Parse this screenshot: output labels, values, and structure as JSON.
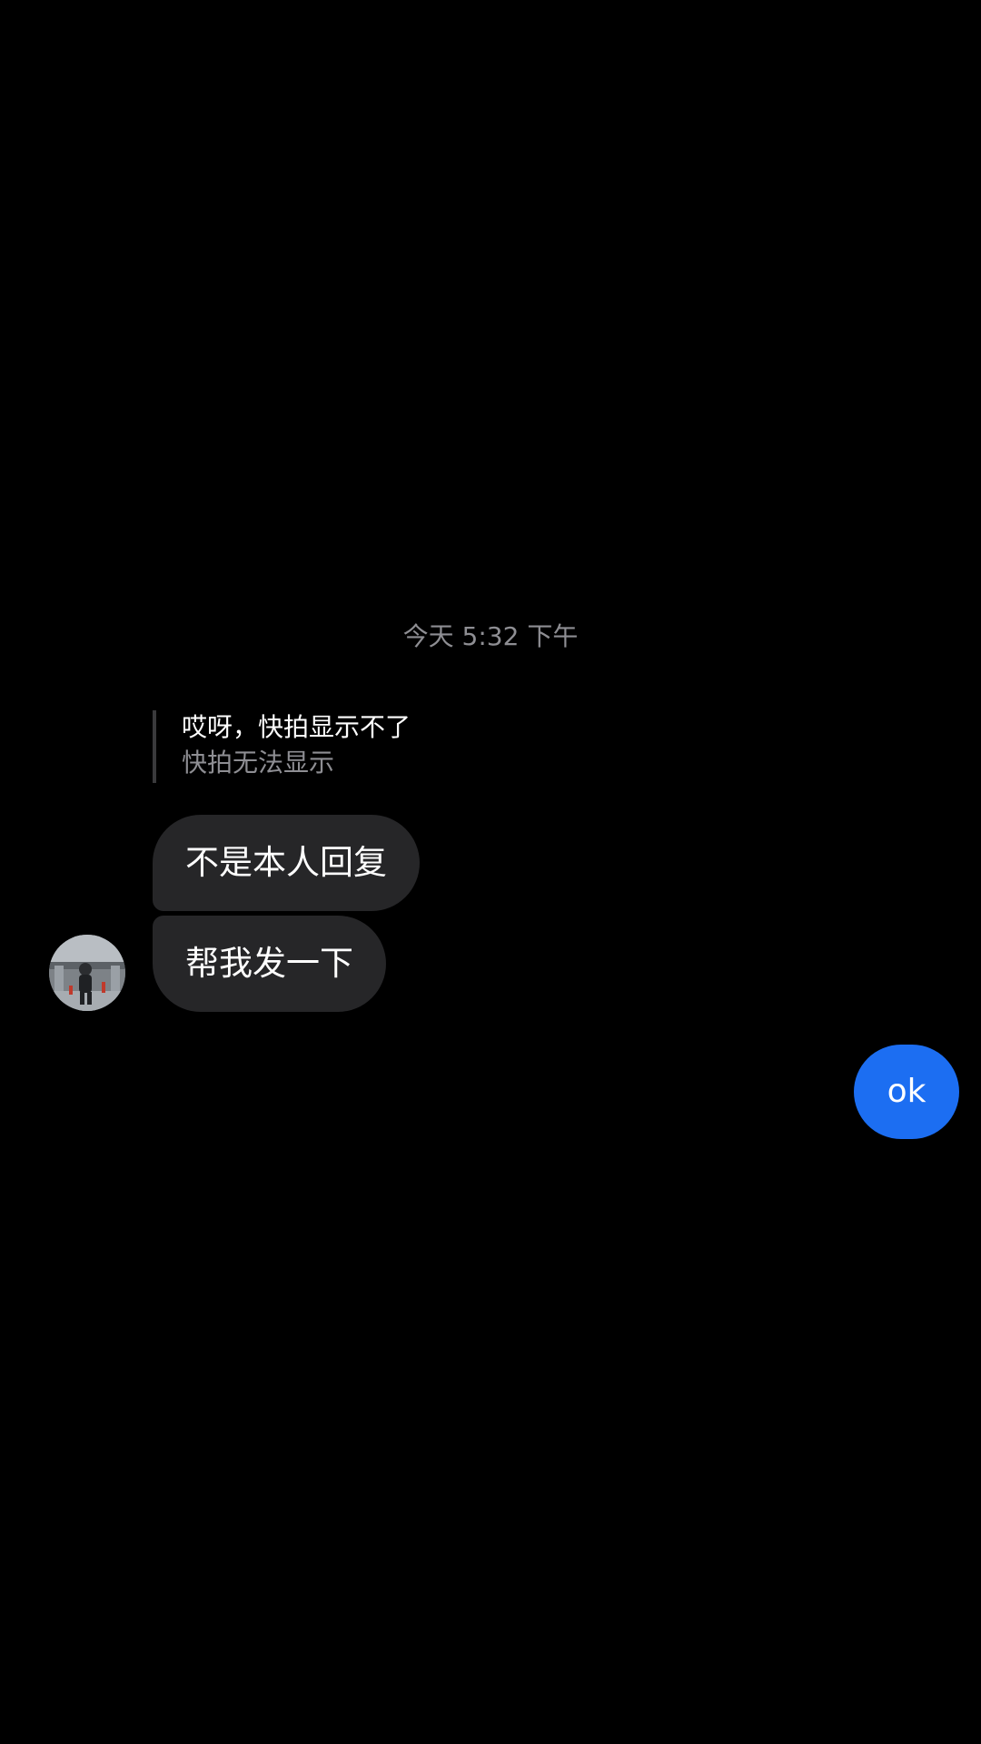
{
  "chat": {
    "timestamp": "今天 5:32 下午",
    "reply": {
      "title": "哎呀，快拍显示不了",
      "subtitle": "快拍无法显示"
    },
    "incoming": [
      {
        "text": "不是本人回复"
      },
      {
        "text": "帮我发一下"
      }
    ],
    "outgoing": [
      {
        "text": "ok"
      }
    ],
    "avatar_icon": "user-photo-avatar",
    "colors": {
      "background": "#000000",
      "incoming_bubble": "#262628",
      "outgoing_bubble": "#1c6ef2",
      "secondary_text": "#8e8e93"
    }
  }
}
